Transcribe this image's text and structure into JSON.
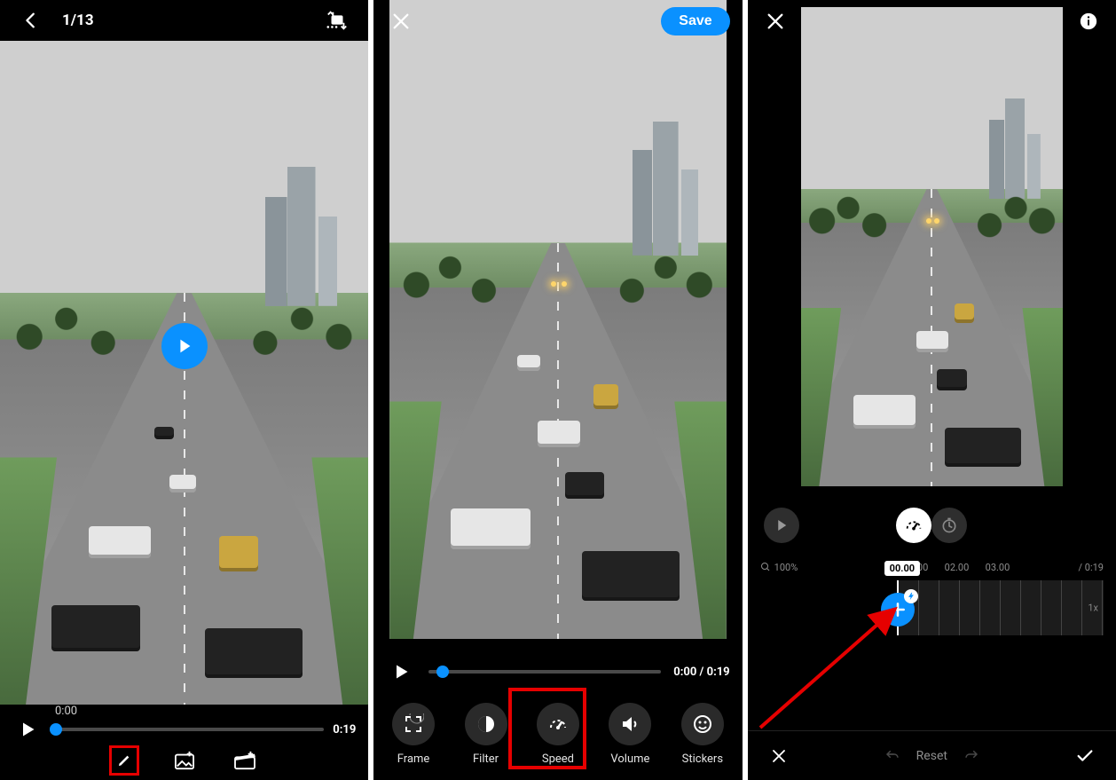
{
  "colors": {
    "accent": "#0a91ff",
    "highlight": "#e60000"
  },
  "panel1": {
    "counter": "1/13",
    "current_time": "0:00",
    "duration": "0:19",
    "toolbar": {
      "edit": "edit",
      "image": "image",
      "clapper": "clapper"
    }
  },
  "panel2": {
    "save_label": "Save",
    "time_display": "0:00 / 0:19",
    "tools": [
      {
        "id": "frame",
        "label": "Frame"
      },
      {
        "id": "filter",
        "label": "Filter"
      },
      {
        "id": "speed",
        "label": "Speed"
      },
      {
        "id": "volume",
        "label": "Volume"
      },
      {
        "id": "stickers",
        "label": "Stickers"
      }
    ]
  },
  "panel3": {
    "zoom_label": "100%",
    "playhead_time": "00.00",
    "ruler": [
      "01.00",
      "02.00",
      "03.00"
    ],
    "total_duration": "/ 0:19",
    "track_speed_label": "1x",
    "reset_label": "Reset"
  }
}
